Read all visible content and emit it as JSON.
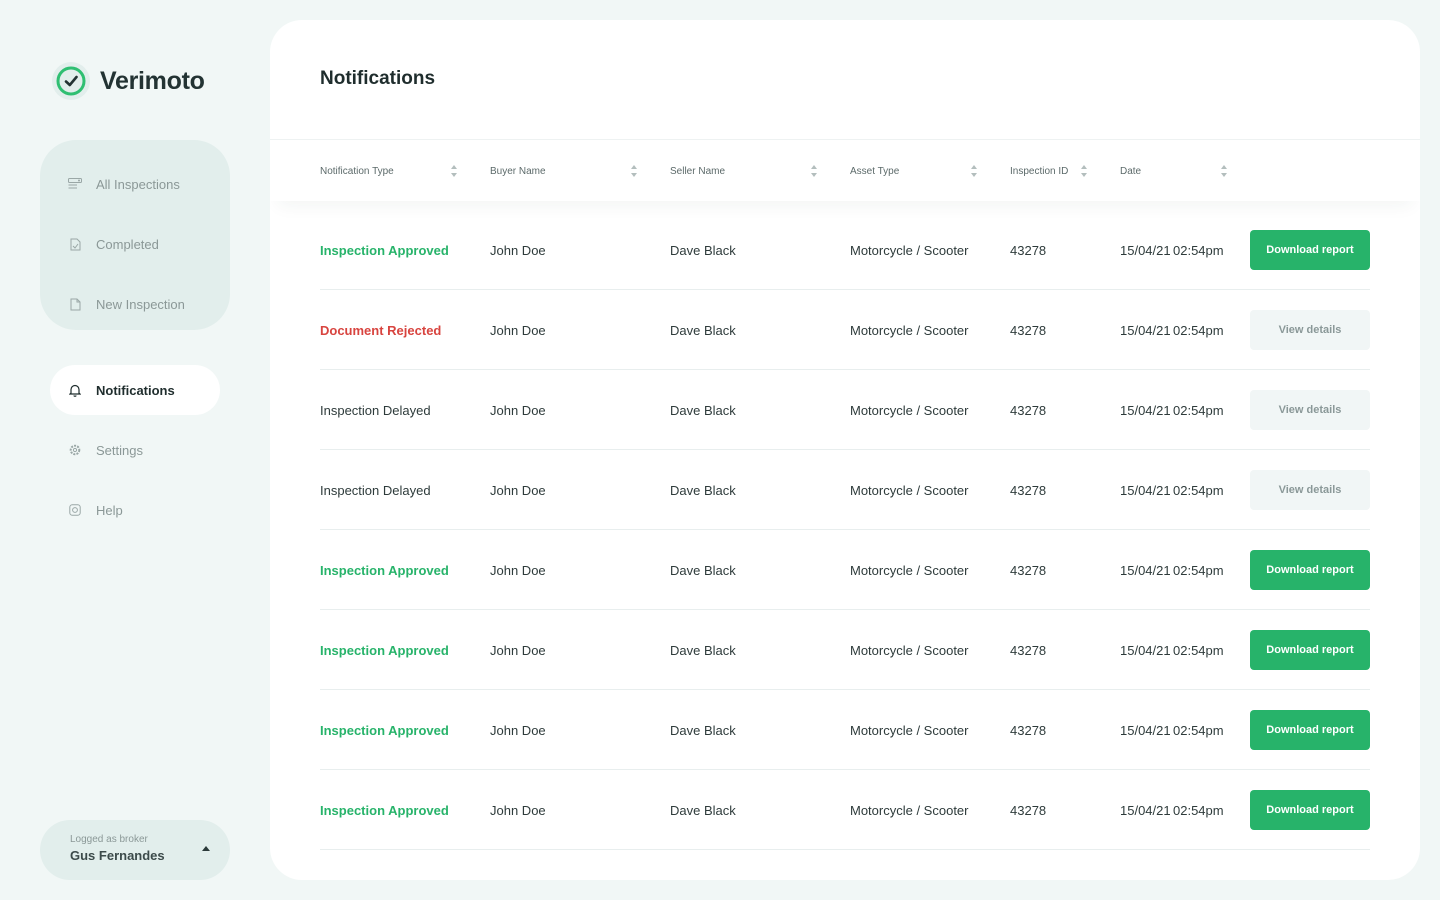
{
  "brand": {
    "name": "Verimoto"
  },
  "sidebar": {
    "group": [
      {
        "label": "All Inspections",
        "icon": "inspections-icon"
      },
      {
        "label": "Completed",
        "icon": "document-check-icon"
      },
      {
        "label": "New Inspection",
        "icon": "document-icon"
      }
    ],
    "notifications": {
      "label": "Notifications",
      "icon": "bell-icon"
    },
    "settings": {
      "label": "Settings",
      "icon": "gear-icon"
    },
    "help": {
      "label": "Help",
      "icon": "help-icon"
    }
  },
  "account": {
    "role_label": "Logged as broker",
    "name": "Gus Fernandes"
  },
  "main": {
    "title": "Notifications",
    "columns": [
      "Notification Type",
      "Buyer Name",
      "Seller Name",
      "Asset Type",
      "Inspection ID",
      "Date"
    ],
    "rows": [
      {
        "type": "Inspection Approved",
        "status": "approved",
        "buyer": "John Doe",
        "seller": "Dave Black",
        "asset": "Motorcycle / Scooter",
        "id": "43278",
        "date": "15/04/21",
        "time": "02:54pm",
        "action": "Download report"
      },
      {
        "type": "Document Rejected",
        "status": "rejected",
        "buyer": "John Doe",
        "seller": "Dave Black",
        "asset": "Motorcycle / Scooter",
        "id": "43278",
        "date": "15/04/21",
        "time": "02:54pm",
        "action": "View details"
      },
      {
        "type": "Inspection Delayed",
        "status": "delayed",
        "buyer": "John Doe",
        "seller": "Dave Black",
        "asset": "Motorcycle / Scooter",
        "id": "43278",
        "date": "15/04/21",
        "time": "02:54pm",
        "action": "View details"
      },
      {
        "type": "Inspection Delayed",
        "status": "delayed",
        "buyer": "John Doe",
        "seller": "Dave Black",
        "asset": "Motorcycle / Scooter",
        "id": "43278",
        "date": "15/04/21",
        "time": "02:54pm",
        "action": "View details"
      },
      {
        "type": "Inspection Approved",
        "status": "approved",
        "buyer": "John Doe",
        "seller": "Dave Black",
        "asset": "Motorcycle / Scooter",
        "id": "43278",
        "date": "15/04/21",
        "time": "02:54pm",
        "action": "Download report"
      },
      {
        "type": "Inspection Approved",
        "status": "approved",
        "buyer": "John Doe",
        "seller": "Dave Black",
        "asset": "Motorcycle / Scooter",
        "id": "43278",
        "date": "15/04/21",
        "time": "02:54pm",
        "action": "Download report"
      },
      {
        "type": "Inspection Approved",
        "status": "approved",
        "buyer": "John Doe",
        "seller": "Dave Black",
        "asset": "Motorcycle / Scooter",
        "id": "43278",
        "date": "15/04/21",
        "time": "02:54pm",
        "action": "Download report"
      },
      {
        "type": "Inspection Approved",
        "status": "approved",
        "buyer": "John Doe",
        "seller": "Dave Black",
        "asset": "Motorcycle / Scooter",
        "id": "43278",
        "date": "15/04/21",
        "time": "02:54pm",
        "action": "Download report"
      }
    ]
  },
  "colors": {
    "accent": "#27b36a",
    "rejected": "#d8443f",
    "background": "#f1f7f6",
    "panel": "#e2eeec"
  }
}
